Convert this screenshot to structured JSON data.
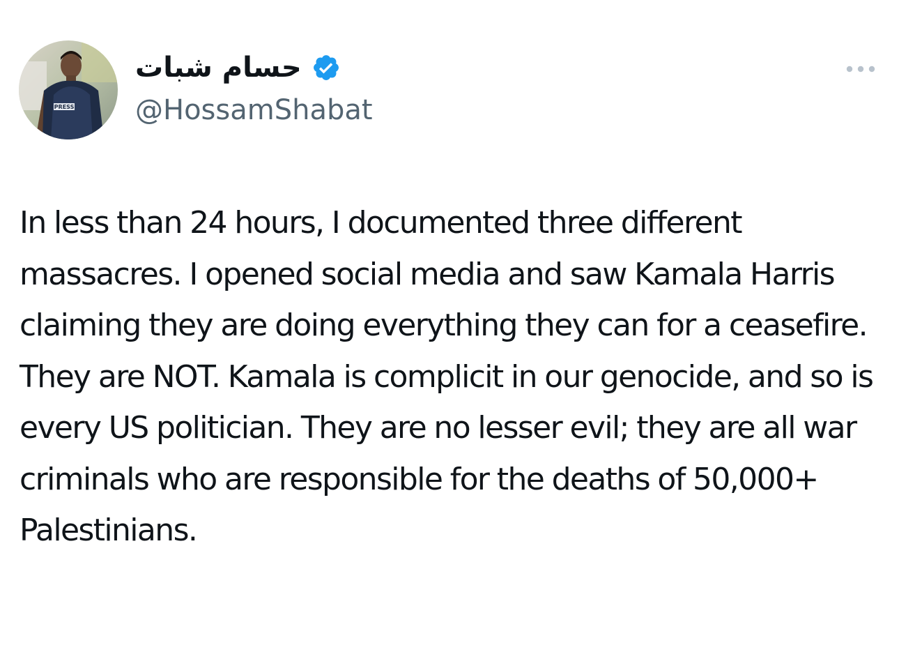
{
  "tweet": {
    "author": {
      "display_name": "حسام شبات",
      "handle": "@HossamShabat",
      "verified": true,
      "avatar_badge_text": "PRESS"
    },
    "text": "In less than 24 hours, I documented three different massacres. I opened social media and saw Kamala Harris claiming they are doing everything they can for a ceasefire. They are NOT. Kamala is complicit in our genocide, and so is every US politician. They are no lesser evil; they are all war criminals who are responsible for the deaths of 50,000+ Palestinians."
  },
  "icons": {
    "verified": "verified-badge-icon",
    "more": "more-options-icon"
  },
  "colors": {
    "verified_blue": "#1d9bf0",
    "text_primary": "#0f1419",
    "text_secondary": "#536471"
  }
}
